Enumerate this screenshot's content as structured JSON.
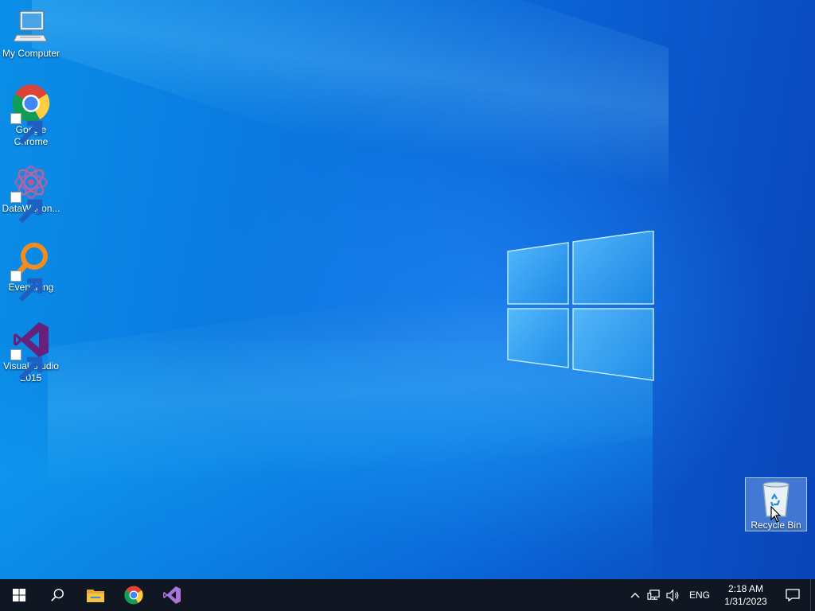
{
  "desktop": {
    "icons": [
      {
        "label": "My Computer",
        "icon": "computer-icon",
        "shortcut": false
      },
      {
        "label": "Google Chrome",
        "icon": "chrome-icon",
        "shortcut": true
      },
      {
        "label": "DataWagon...",
        "icon": "datawagon-icon",
        "shortcut": true
      },
      {
        "label": "Everything",
        "icon": "everything-search-icon",
        "shortcut": true
      },
      {
        "label": "Visual Studio 2015",
        "icon": "visual-studio-icon",
        "shortcut": true
      },
      {
        "label": "Recycle Bin",
        "icon": "recycle-bin-icon",
        "shortcut": false,
        "selected": true
      }
    ]
  },
  "taskbar": {
    "start_icon": "windows-start-icon",
    "search_icon": "search-icon",
    "pinned": [
      {
        "name": "File Explorer",
        "icon": "folder-icon"
      },
      {
        "name": "Google Chrome",
        "icon": "chrome-icon"
      },
      {
        "name": "Visual Studio",
        "icon": "visual-studio-icon"
      }
    ],
    "tray": {
      "chevron_icon": "chevron-up-icon",
      "network_icon": "network-icon",
      "volume_icon": "speaker-icon",
      "language": "ENG",
      "time": "2:18 AM",
      "date": "1/31/2023",
      "notification_icon": "action-center-icon"
    }
  },
  "colors": {
    "taskbar_bg": "#101722",
    "wallpaper_accent": "#0a64d6"
  }
}
